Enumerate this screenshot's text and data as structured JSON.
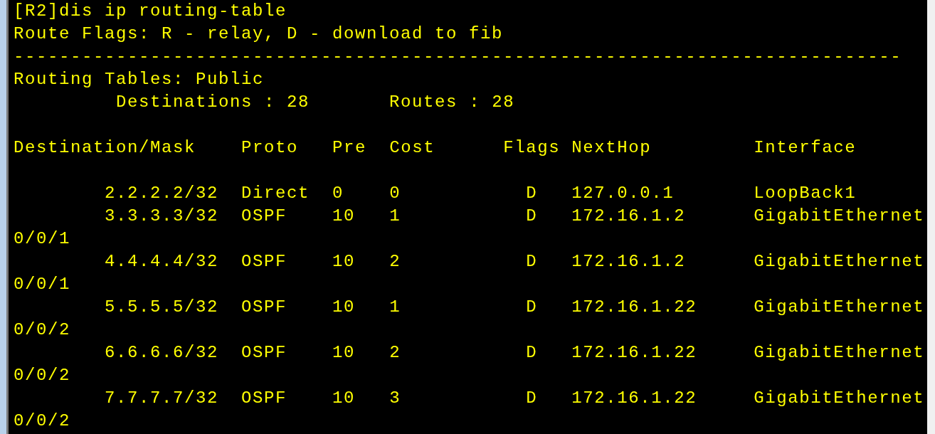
{
  "command": "[R2]dis ip routing-table",
  "flags_legend": "Route Flags: R - relay, D - download to fib",
  "separator": "------------------------------------------------------------------------------",
  "table_title": "Routing Tables: Public",
  "summary": [
    "Destinations : 28",
    "Routes : 28"
  ],
  "columns": [
    "Destination/Mask",
    "Proto",
    "Pre",
    "Cost",
    "Flags",
    "NextHop",
    "Interface"
  ],
  "rows": [
    {
      "destination": "2.2.2.2/32",
      "proto": "Direct",
      "pre": "0",
      "cost": "0",
      "flags": "D",
      "nexthop": "127.0.0.1",
      "interface": "LoopBack1"
    },
    {
      "destination": "3.3.3.3/32",
      "proto": "OSPF",
      "pre": "10",
      "cost": "1",
      "flags": "D",
      "nexthop": "172.16.1.2",
      "interface": "GigabitEthernet",
      "interface_wrapped": "0/0/1"
    },
    {
      "destination": "4.4.4.4/32",
      "proto": "OSPF",
      "pre": "10",
      "cost": "2",
      "flags": "D",
      "nexthop": "172.16.1.2",
      "interface": "GigabitEthernet",
      "interface_wrapped": "0/0/1"
    },
    {
      "destination": "5.5.5.5/32",
      "proto": "OSPF",
      "pre": "10",
      "cost": "1",
      "flags": "D",
      "nexthop": "172.16.1.22",
      "interface": "GigabitEthernet",
      "interface_wrapped": "0/0/2"
    },
    {
      "destination": "6.6.6.6/32",
      "proto": "OSPF",
      "pre": "10",
      "cost": "2",
      "flags": "D",
      "nexthop": "172.16.1.22",
      "interface": "GigabitEthernet",
      "interface_wrapped": "0/0/2"
    },
    {
      "destination": "7.7.7.7/32",
      "proto": "OSPF",
      "pre": "10",
      "cost": "3",
      "flags": "D",
      "nexthop": "172.16.1.22",
      "interface": "GigabitEthernet",
      "interface_wrapped": "0/0/2"
    }
  ]
}
